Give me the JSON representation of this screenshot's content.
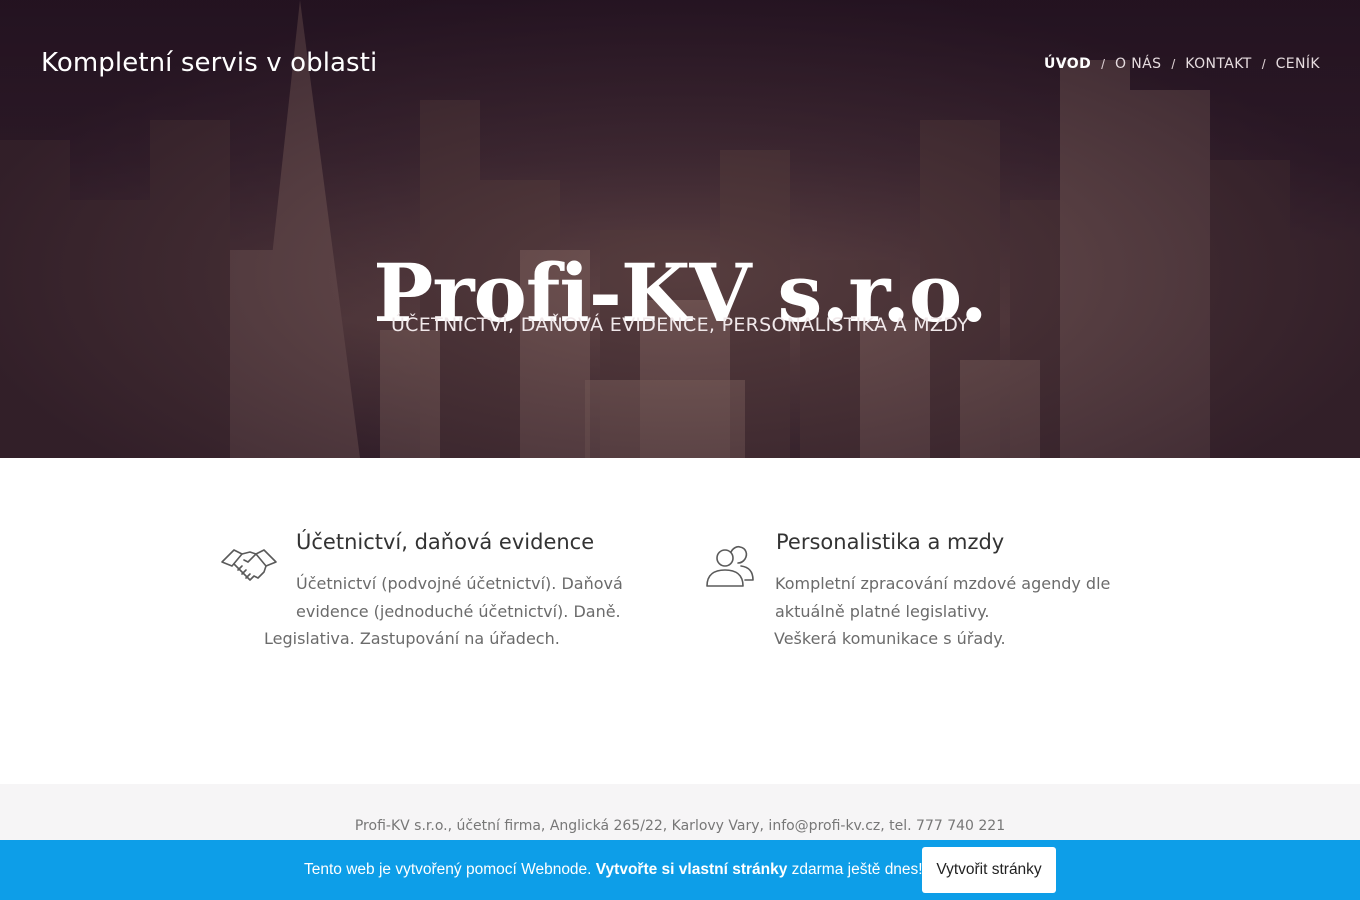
{
  "header": {
    "brand": "Kompletní servis v oblasti",
    "nav": [
      {
        "label": "ÚVOD",
        "active": true
      },
      {
        "label": "O NÁS",
        "active": false
      },
      {
        "label": "KONTAKT",
        "active": false
      },
      {
        "label": "CENÍK",
        "active": false
      }
    ],
    "nav_separator": "/"
  },
  "hero": {
    "title": "Profi-KV s.r.o.",
    "subtitle": "ÚČETNICTVÍ, DAŇOVÁ EVIDENCE, PERSONALISTIKA A MZDY"
  },
  "features": [
    {
      "icon": "handshake-icon",
      "title": "Účetnictví, daňová evidence",
      "lines": [
        "Účetnictví (podvojné účetnictví). Daňová",
        "evidence (jednoduché účetnictví). Daně.",
        "Legislativa. Zastupování na úřadech."
      ]
    },
    {
      "icon": "people-icon",
      "title": "Personalistika a mzdy",
      "lines": [
        "Kompletní zpracování mzdové agendy dle",
        "aktuálně platné legislativy.",
        "Veškerá komunikace s úřady."
      ]
    }
  ],
  "footer": {
    "text": "Profi-KV s.r.o., účetní firma, Anglická 265/22, Karlovy Vary, info@profi-kv.cz, tel. 777 740 221"
  },
  "promo": {
    "text_before": "Tento web je vytvořený pomocí Webnode. ",
    "text_bold": "Vytvořte si vlastní stránky",
    "text_after": " zdarma ještě dnes!",
    "button": "Vytvořit stránky",
    "color": "#0d9ee8"
  }
}
